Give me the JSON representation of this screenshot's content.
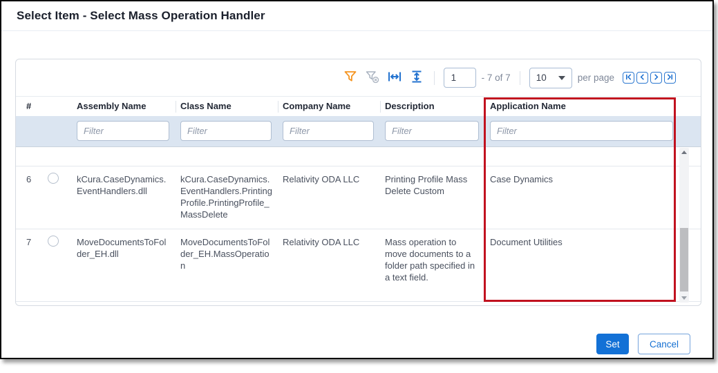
{
  "dialog": {
    "title": "Select Item - Select Mass Operation Handler"
  },
  "toolbar": {
    "filter_icon": "filter-funnel",
    "clear_filters_icon": "filter-funnel-clear",
    "fit_column_width_icon": "column-width-arrows",
    "fit_row_height_icon": "row-height-arrows",
    "page_value": "1",
    "range_label": "- 7 of 7",
    "page_size_value": "10",
    "per_page_label": "per page"
  },
  "table": {
    "columns": [
      "#",
      "Assembly Name",
      "Class Name",
      "Company Name",
      "Description",
      "Application Name"
    ],
    "filter_placeholder": "Filter",
    "rows": [
      {
        "num": "6",
        "assembly_name": "kCura.CaseDynamics.EventHandlers.dll",
        "class_name": "kCura.CaseDynamics.EventHandlers.PrintingProfile.PrintingProfile_MassDelete",
        "company_name": "Relativity ODA LLC",
        "description": "Printing Profile Mass Delete Custom",
        "application_name": "Case Dynamics"
      },
      {
        "num": "7",
        "assembly_name": "MoveDocumentsToFolder_EH.dll",
        "class_name": "MoveDocumentsToFolder_EH.MassOperation",
        "company_name": "Relativity ODA LLC",
        "description": "Mass operation to move documents to a folder path specified in a text field.",
        "application_name": "Document Utilities"
      }
    ]
  },
  "footer": {
    "set_label": "Set",
    "cancel_label": "Cancel"
  },
  "annotation": {
    "highlighted_column": "Application Name",
    "highlight_color": "#c1121f"
  },
  "colors": {
    "accent_blue": "#1371d6",
    "funnel_orange": "#f5941f",
    "filter_row_bg": "#dbe5f1"
  }
}
